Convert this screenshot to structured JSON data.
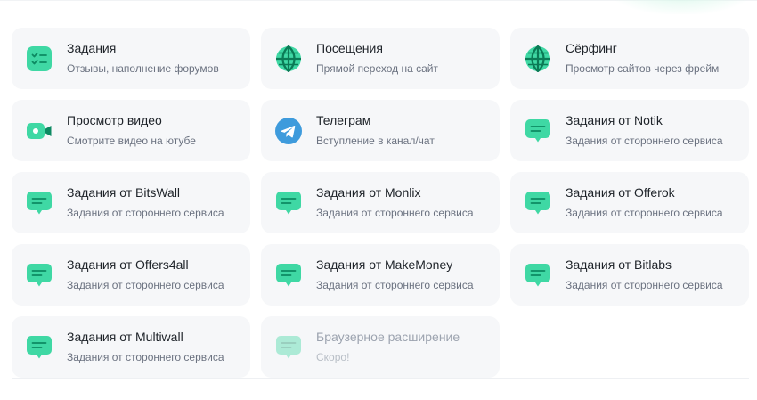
{
  "colors": {
    "accent": "#3fd8a4",
    "telegram": "#3e9bdc",
    "card_bg": "#f6f7f9"
  },
  "cards": [
    {
      "title": "Задания",
      "subtitle": "Отзывы, наполнение форумов",
      "icon": "checklist-icon"
    },
    {
      "title": "Посещения",
      "subtitle": "Прямой переход на сайт",
      "icon": "globe-icon"
    },
    {
      "title": "Сёрфинг",
      "subtitle": "Просмотр сайтов через фрейм",
      "icon": "globe-icon"
    },
    {
      "title": "Просмотр видео",
      "subtitle": "Смотрите видео на ютубе",
      "icon": "video-camera-icon"
    },
    {
      "title": "Телеграм",
      "subtitle": "Вступление в канал/чат",
      "icon": "telegram-icon"
    },
    {
      "title": "Задания от Notik",
      "subtitle": "Задания от стороннего сервиса",
      "icon": "chat-bubble-icon"
    },
    {
      "title": "Задания от BitsWall",
      "subtitle": "Задания от стороннего сервиса",
      "icon": "chat-bubble-icon"
    },
    {
      "title": "Задания от Monlix",
      "subtitle": "Задания от стороннего сервиса",
      "icon": "chat-bubble-icon"
    },
    {
      "title": "Задания от Offerok",
      "subtitle": "Задания от стороннего сервиса",
      "icon": "chat-bubble-icon"
    },
    {
      "title": "Задания от Offers4all",
      "subtitle": "Задания от стороннего сервиса",
      "icon": "chat-bubble-icon"
    },
    {
      "title": "Задания от MakeMoney",
      "subtitle": "Задания от стороннего сервиса",
      "icon": "chat-bubble-icon"
    },
    {
      "title": "Задания от Bitlabs",
      "subtitle": "Задания от стороннего сервиса",
      "icon": "chat-bubble-icon"
    },
    {
      "title": "Задания от Multiwall",
      "subtitle": "Задания от стороннего сервиса",
      "icon": "chat-bubble-icon"
    },
    {
      "title": "Браузерное расширение",
      "subtitle": "Скоро!",
      "icon": "chat-bubble-icon",
      "disabled": true
    }
  ]
}
